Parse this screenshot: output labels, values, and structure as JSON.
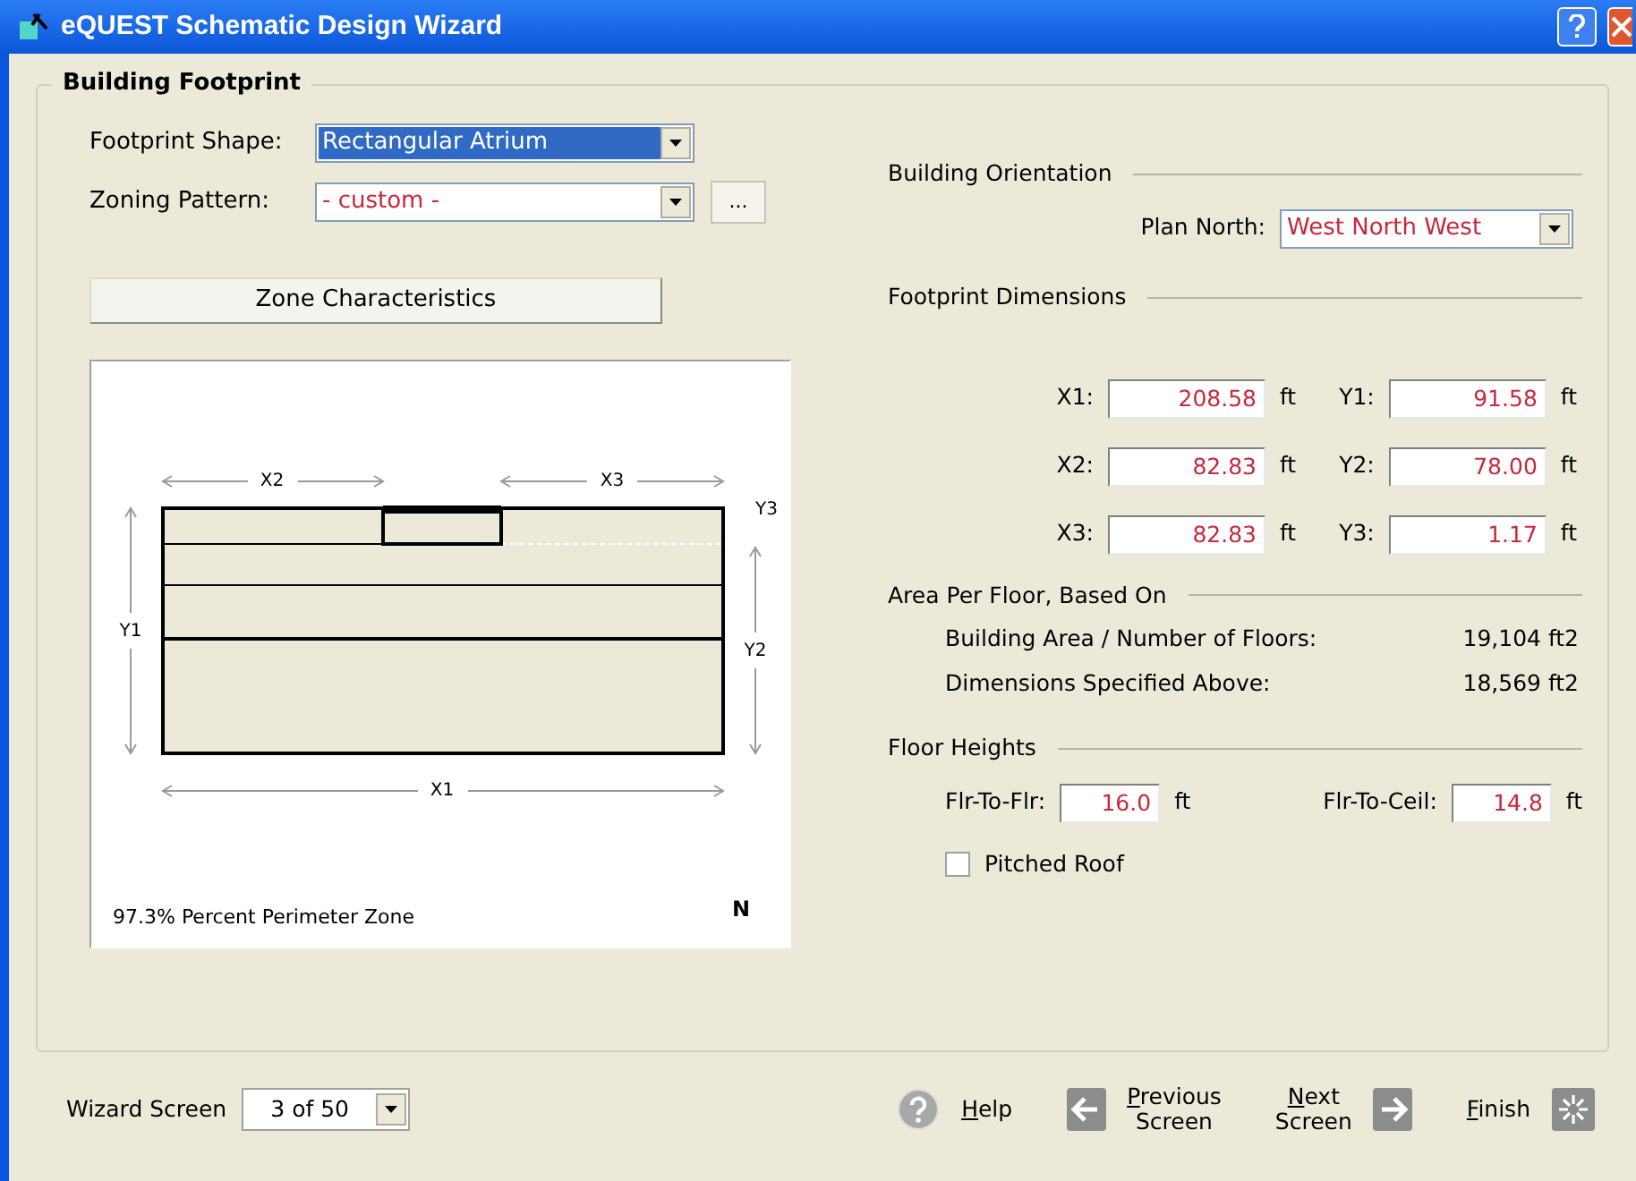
{
  "window": {
    "title": "eQUEST Schematic Design Wizard"
  },
  "group_title": "Building Footprint",
  "footprint_shape": {
    "label": "Footprint Shape:",
    "value": "Rectangular Atrium",
    "focused": true
  },
  "zoning_pattern": {
    "label": "Zoning Pattern:",
    "value": "- custom -",
    "more_button": "..."
  },
  "zone_characteristics_button": "Zone Characteristics",
  "diagram": {
    "x1": "X1",
    "x2": "X2",
    "x3": "X3",
    "y1": "Y1",
    "y2": "Y2",
    "y3": "Y3",
    "caption": "97.3% Percent Perimeter Zone",
    "north": "N"
  },
  "orientation": {
    "heading": "Building Orientation",
    "label": "Plan North:",
    "value": "West North West"
  },
  "dimensions": {
    "heading": "Footprint Dimensions",
    "rows": [
      [
        {
          "label": "X1:",
          "value": "208.58",
          "unit": "ft"
        },
        {
          "label": "Y1:",
          "value": "91.58",
          "unit": "ft"
        }
      ],
      [
        {
          "label": "X2:",
          "value": "82.83",
          "unit": "ft"
        },
        {
          "label": "Y2:",
          "value": "78.00",
          "unit": "ft"
        }
      ],
      [
        {
          "label": "X3:",
          "value": "82.83",
          "unit": "ft"
        },
        {
          "label": "Y3:",
          "value": "1.17",
          "unit": "ft"
        }
      ]
    ]
  },
  "area": {
    "heading": "Area Per Floor, Based On",
    "rows": [
      {
        "label": "Building Area / Number of Floors:",
        "value": "19,104 ft2"
      },
      {
        "label": "Dimensions Specified Above:",
        "value": "18,569 ft2"
      }
    ]
  },
  "floor_heights": {
    "heading": "Floor Heights",
    "fields": [
      {
        "label": "Flr-To-Flr:",
        "value": "16.0",
        "unit": "ft"
      },
      {
        "label": "Flr-To-Ceil:",
        "value": "14.8",
        "unit": "ft"
      }
    ]
  },
  "pitched_roof": {
    "label": "Pitched Roof",
    "checked": false
  },
  "footer": {
    "label": "Wizard Screen",
    "value": "3 of 50",
    "buttons": [
      {
        "kind": "help",
        "lines": [
          "Help"
        ]
      },
      {
        "kind": "previous",
        "lines": [
          "Previous",
          "Screen"
        ]
      },
      {
        "kind": "next",
        "lines": [
          "Next",
          "Screen"
        ]
      },
      {
        "kind": "finish",
        "lines": [
          "Finish"
        ]
      }
    ]
  }
}
